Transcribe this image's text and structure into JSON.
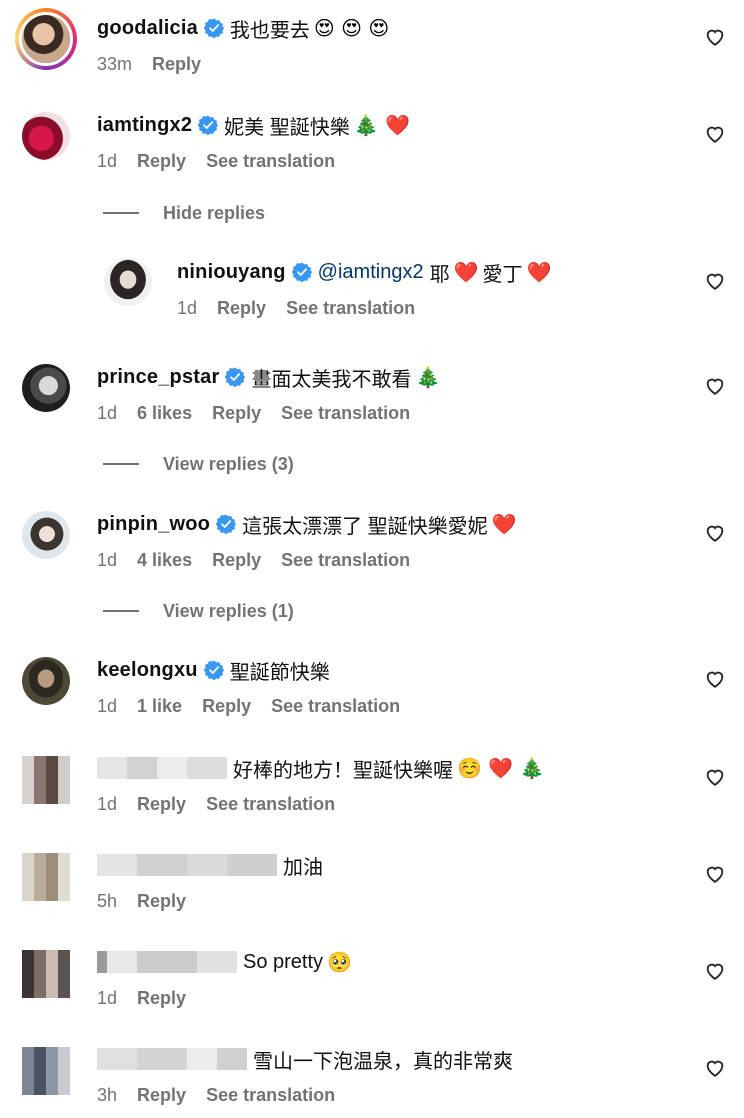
{
  "labels": {
    "reply": "Reply",
    "see_translation": "See translation",
    "hide_replies": "Hide replies"
  },
  "comments": [
    {
      "username": "goodalicia",
      "text": "我也要去",
      "emoji": "😍 😍 😍",
      "time": "33m",
      "likes": "",
      "translation": false
    },
    {
      "username": "iamtingx2",
      "text": "妮美 聖誕快樂",
      "emoji": "🎄 ❤️",
      "time": "1d",
      "likes": "",
      "translation": true
    },
    {
      "username": "prince_pstar",
      "text": "畫面太美我不敢看",
      "emoji": "🎄",
      "time": "1d",
      "likes": "6 likes",
      "translation": true,
      "view_replies": "View replies (3)"
    },
    {
      "username": "pinpin_woo",
      "text": "這張太漂漂了 聖誕快樂愛妮",
      "emoji": "❤️",
      "time": "1d",
      "likes": "4 likes",
      "translation": true,
      "view_replies": "View replies (1)"
    },
    {
      "username": "keelongxu",
      "text": "聖誕節快樂",
      "emoji": "",
      "time": "1d",
      "likes": "1 like",
      "translation": true
    },
    {
      "username": "",
      "text": "好棒的地方！聖誕快樂喔",
      "emoji": "☺️ ❤️ 🎄",
      "time": "1d",
      "likes": "",
      "translation": true
    },
    {
      "username": "",
      "text": "加油",
      "emoji": "",
      "time": "5h",
      "likes": "",
      "translation": false
    },
    {
      "username": "",
      "text": "So pretty",
      "emoji": "🥺",
      "time": "1d",
      "likes": "",
      "translation": false
    },
    {
      "username": "",
      "text": "雪山一下泡温泉，真的非常爽",
      "emoji": "",
      "time": "3h",
      "likes": "",
      "translation": true
    }
  ],
  "reply": {
    "username": "niniouyang",
    "mention": "@iamtingx2",
    "text": "耶",
    "emoji1": "❤️",
    "text2": "愛丁",
    "emoji2": "❤️",
    "time": "1d"
  },
  "colors": {
    "verified": "#3897f0",
    "secondary": "#737373",
    "mention": "#00376b"
  }
}
